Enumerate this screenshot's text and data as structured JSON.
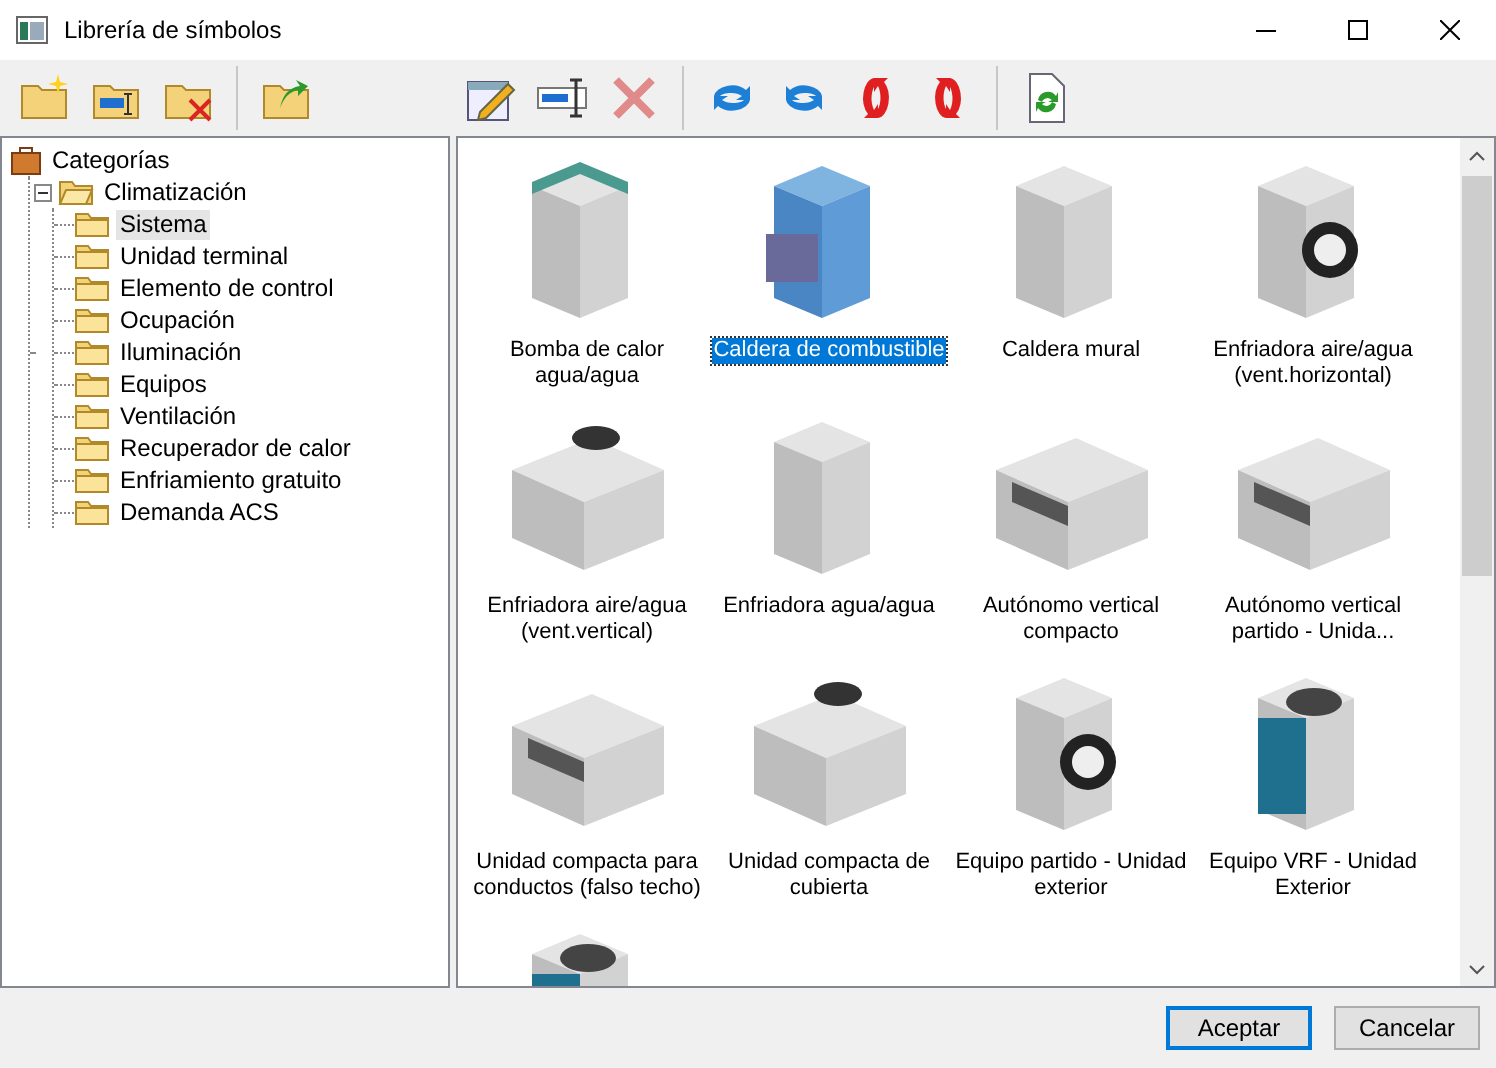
{
  "window": {
    "title": "Librería de símbolos"
  },
  "tree": {
    "label": "Categorías",
    "selected": false,
    "children": [
      {
        "label": "Climatización",
        "expanded": true,
        "selected": false,
        "children": [
          {
            "label": "Sistema",
            "selected": true
          },
          {
            "label": "Unidad terminal",
            "selected": false
          },
          {
            "label": "Elemento de control",
            "selected": false
          },
          {
            "label": "Ocupación",
            "selected": false
          },
          {
            "label": "Iluminación",
            "selected": false
          },
          {
            "label": "Equipos",
            "selected": false
          },
          {
            "label": "Ventilación",
            "selected": false
          },
          {
            "label": "Recuperador de calor",
            "selected": false
          },
          {
            "label": "Enfriamiento gratuito",
            "selected": false
          },
          {
            "label": "Demanda ACS",
            "selected": false
          }
        ]
      }
    ]
  },
  "symbols": [
    {
      "label": "Bomba de calor agua/agua",
      "selected": false
    },
    {
      "label": "Caldera de combustible",
      "selected": true
    },
    {
      "label": "Caldera mural",
      "selected": false
    },
    {
      "label": "Enfriadora aire/agua (vent.horizontal)",
      "selected": false
    },
    {
      "label": "Enfriadora aire/agua (vent.vertical)",
      "selected": false
    },
    {
      "label": "Enfriadora agua/agua",
      "selected": false
    },
    {
      "label": "Autónomo vertical compacto",
      "selected": false
    },
    {
      "label": "Autónomo vertical partido - Unida...",
      "selected": false
    },
    {
      "label": "Unidad compacta para conductos (falso techo)",
      "selected": false
    },
    {
      "label": "Unidad compacta de cubierta",
      "selected": false
    },
    {
      "label": "Equipo partido - Unidad exterior",
      "selected": false
    },
    {
      "label": "Equipo VRF - Unidad Exterior",
      "selected": false
    }
  ],
  "buttons": [
    {
      "label": "Aceptar",
      "default": true
    },
    {
      "label": "Cancelar",
      "default": false
    }
  ]
}
